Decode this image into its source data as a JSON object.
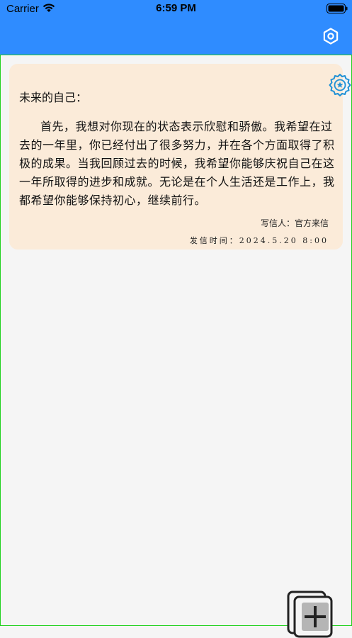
{
  "status_bar": {
    "carrier": "Carrier",
    "time": "6:59 PM"
  },
  "header": {
    "background_color": "#2f8cff",
    "settings_icon": "gear-icon"
  },
  "letters": [
    {
      "salutation": "未来的自己：",
      "body": "首先，我想对你现在的状态表示欣慰和骄傲。我希望在过去的一年里，你已经付出了很多努力，并在各个方面取得了积极的成果。当我回顾过去的时候，我希望你能够庆祝自己在这一年所取得的进步和成就。无论是在个人生活还是工作上，我都希望你能够保持初心，继续前行。",
      "sender": "写信人：官方来信",
      "send_time": "发信时间：2024.5.20 8:00",
      "badge_icon": "award-badge-icon",
      "card_color": "#fbebd9"
    }
  ],
  "add_button_icon": "add-letter-icon"
}
